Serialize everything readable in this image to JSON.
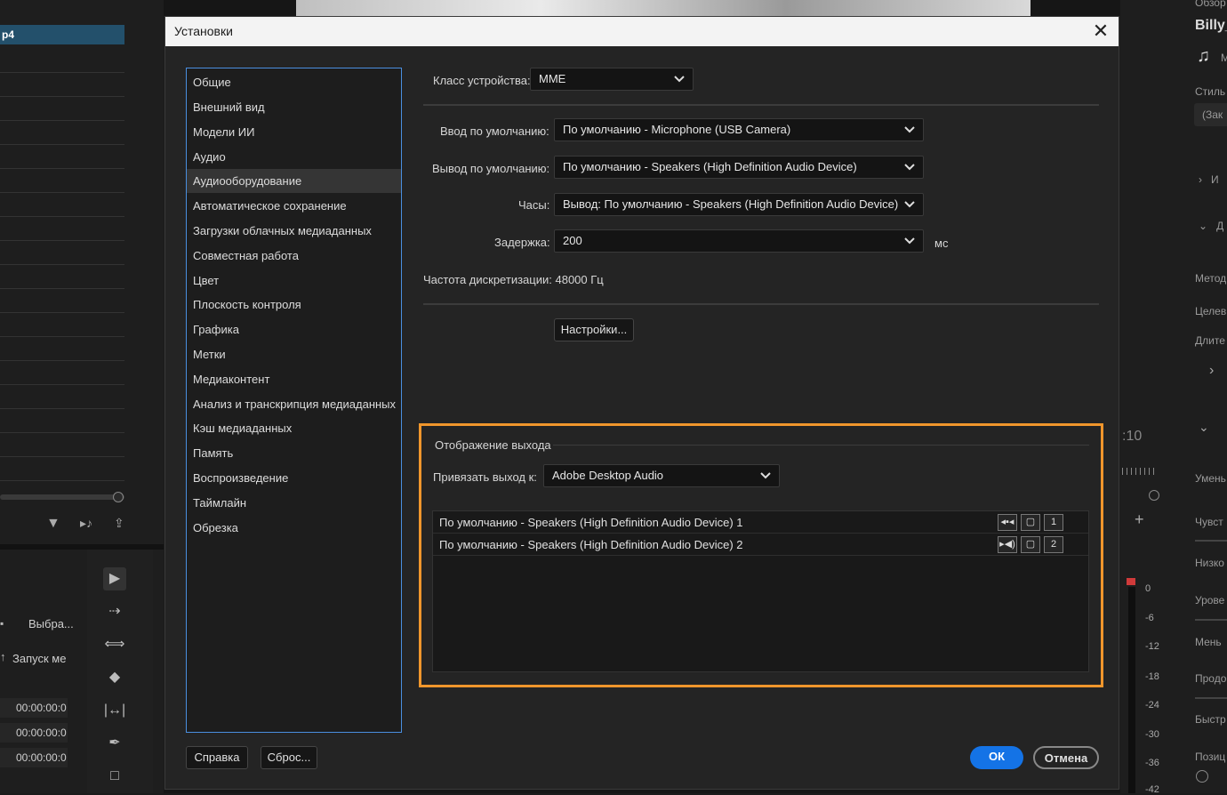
{
  "background": {
    "left_panel_item": "p4",
    "left_labels": [
      "Выбра...",
      "Запуск ме"
    ],
    "timecodes": [
      "00:00:00:0",
      "00:00:00:0",
      "00:00:00:0"
    ],
    "top_right_title": "Обзор",
    "top_right_name": "Billy_",
    "top_right_sub": "М",
    "right_labels": [
      "Стиль",
      "(Зак",
      "И",
      "Д",
      "Метод",
      "Целев",
      "Длите",
      "Умень",
      "Чувст",
      "Низко",
      "Урове",
      "Мень",
      "Продо",
      "Быстр",
      "Позиц"
    ],
    "timecode_right": ":10",
    "meter_ticks": [
      "0",
      "-6",
      "-12",
      "-18",
      "-24",
      "-30",
      "-36",
      "-42"
    ],
    "colors": {
      "selection": "#23506b",
      "meter_peak": "#d03a3a"
    }
  },
  "dialog": {
    "title": "Установки",
    "close_icon": "close-icon",
    "categories": [
      "Общие",
      "Внешний вид",
      "Модели ИИ",
      "Аудио",
      "Аудиооборудование",
      "Автоматическое сохранение",
      "Загрузки облачных медиаданных",
      "Совместная работа",
      "Цвет",
      "Плоскость контроля",
      "Графика",
      "Метки",
      "Медиаконтент",
      "Анализ и транскрипция медиаданных",
      "Кэш медиаданных",
      "Память",
      "Воспроизведение",
      "Таймлайн",
      "Обрезка"
    ],
    "selected_category": "Аудиооборудование",
    "device_class": {
      "label": "Класс устройства:",
      "value": "MME"
    },
    "default_input": {
      "label": "Ввод по умолчанию:",
      "value": "По умолчанию - Microphone (USB Camera)"
    },
    "default_output": {
      "label": "Вывод по умолчанию:",
      "value": "По умолчанию - Speakers (High Definition Audio Device)"
    },
    "clock": {
      "label": "Часы:",
      "value": "Вывод: По умолчанию - Speakers (High Definition Audio Device)"
    },
    "latency": {
      "label": "Задержка:",
      "value": "200",
      "unit": "мс"
    },
    "sample_rate": {
      "label": "Частота дискретизации:",
      "value": "48000 Гц"
    },
    "settings_button": "Настройки...",
    "output_mapping": {
      "title": "Отображение выхода",
      "map_label": "Привязать выход к:",
      "map_value": "Adobe Desktop Audio",
      "rows": [
        {
          "name": "По умолчанию - Speakers (High Definition Audio Device) 1",
          "channel": "1",
          "speaker_icon": "speaker-left-icon"
        },
        {
          "name": "По умолчанию - Speakers (High Definition Audio Device) 2",
          "channel": "2",
          "speaker_icon": "speaker-right-icon"
        }
      ],
      "accent_color": "#f0962c"
    },
    "help_button": "Справка",
    "reset_button": "Сброс...",
    "ok_button": "ОК",
    "cancel_button": "Отмена",
    "ok_color": "#1473e6"
  }
}
